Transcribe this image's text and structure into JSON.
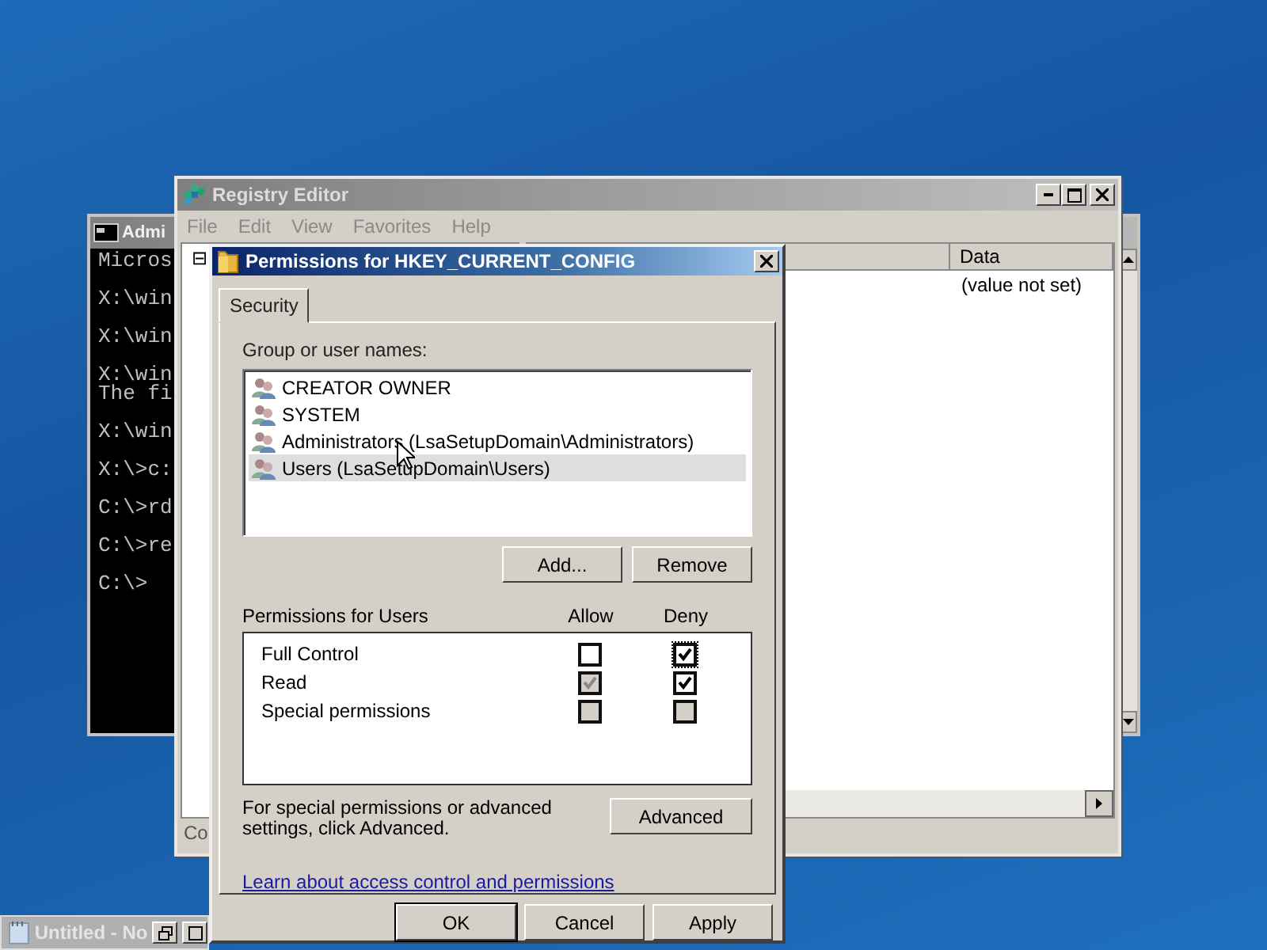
{
  "console_window": {
    "title": "Admi",
    "lines": [
      {
        "text": "Micros",
        "blank_before": false
      },
      {
        "text": "X:\\win",
        "blank_before": true
      },
      {
        "text": "X:\\win",
        "blank_before": true
      },
      {
        "text": "X:\\win",
        "blank_before": true
      },
      {
        "text": "The fi",
        "blank_before": false
      },
      {
        "text": "X:\\win",
        "blank_before": true
      },
      {
        "text": "X:\\>c:",
        "blank_before": true
      },
      {
        "text": "C:\\>rd",
        "blank_before": true
      },
      {
        "text": "C:\\>re",
        "blank_before": true
      },
      {
        "text": "C:\\>",
        "blank_before": true
      }
    ]
  },
  "registry_window": {
    "title": "Registry Editor",
    "menu": [
      "File",
      "Edit",
      "View",
      "Favorites",
      "Help"
    ],
    "tree_toggle": "⊟",
    "columns": [
      "Data"
    ],
    "rows": [
      {
        "data": "(value not set)"
      }
    ],
    "status_bar": "Co"
  },
  "dialog": {
    "title": "Permissions for HKEY_CURRENT_CONFIG",
    "tabs": [
      {
        "label": "Security",
        "selected": true
      }
    ],
    "group_label": "Group or user names:",
    "users": [
      {
        "name": "CREATOR OWNER",
        "selected": false
      },
      {
        "name": "SYSTEM",
        "selected": false
      },
      {
        "name": "Administrators (LsaSetupDomain\\Administrators)",
        "selected": false
      },
      {
        "name": "Users (LsaSetupDomain\\Users)",
        "selected": true
      }
    ],
    "user_buttons": [
      "Add...",
      "Remove"
    ],
    "permissions_label": "Permissions for Users",
    "permission_columns": [
      "Allow",
      "Deny"
    ],
    "permissions": [
      {
        "name": "Full Control",
        "allow": {
          "checked": false,
          "disabled": false,
          "focused": false
        },
        "deny": {
          "checked": true,
          "disabled": false,
          "focused": true
        }
      },
      {
        "name": "Read",
        "allow": {
          "checked": true,
          "disabled": true,
          "focused": false
        },
        "deny": {
          "checked": true,
          "disabled": false,
          "focused": false
        }
      },
      {
        "name": "Special permissions",
        "allow": {
          "checked": false,
          "disabled": true,
          "focused": false
        },
        "deny": {
          "checked": false,
          "disabled": true,
          "focused": false
        }
      }
    ],
    "advanced_text": "For special permissions or advanced settings, click Advanced.",
    "advanced_button": "Advanced",
    "link": "Learn about access control and permissions",
    "footer_buttons": [
      {
        "label": "OK",
        "default": true
      },
      {
        "label": "Cancel",
        "default": false
      },
      {
        "label": "Apply",
        "default": false
      }
    ]
  },
  "minimized_window": {
    "title": "Untitled - No"
  }
}
